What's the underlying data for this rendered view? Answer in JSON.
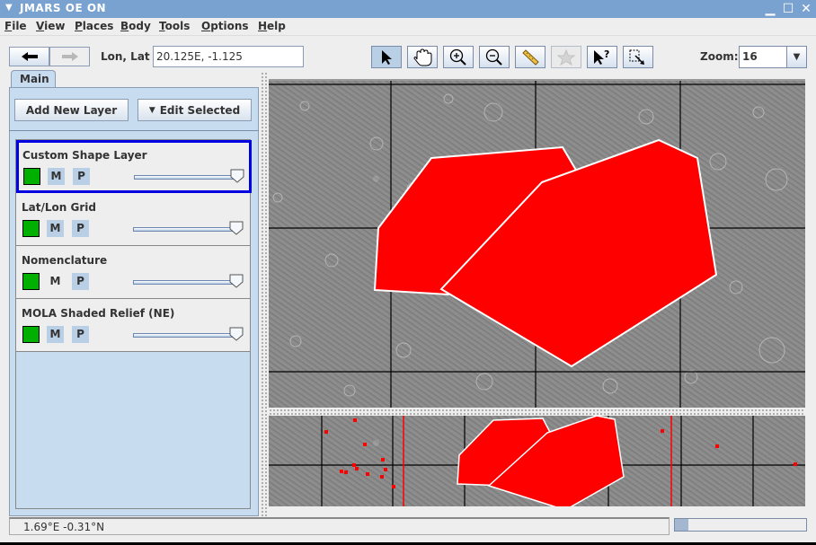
{
  "window": {
    "title": "JMARS OE ON",
    "menu_icon": "triangle-down-icon",
    "controls": [
      "minimize-icon",
      "maximize-icon",
      "close-icon"
    ]
  },
  "menubar": {
    "items": [
      {
        "label": "File",
        "mnemonic": "F",
        "rest": "ile"
      },
      {
        "label": "View",
        "mnemonic": "V",
        "rest": "iew"
      },
      {
        "label": "Places",
        "mnemonic": "P",
        "rest": "laces"
      },
      {
        "label": "Body",
        "mnemonic": "B",
        "rest": "ody"
      },
      {
        "label": "Tools",
        "mnemonic": "T",
        "rest": "ools"
      },
      {
        "label": "Options",
        "mnemonic": "O",
        "rest": "ptions"
      },
      {
        "label": "Help",
        "mnemonic": "H",
        "rest": "elp"
      }
    ]
  },
  "toolbar": {
    "back_icon": "arrow-left-icon",
    "forward_icon": "arrow-right-icon",
    "lonlat_label": "Lon, Lat",
    "lonlat_value": "20.125E, -1.125",
    "tools": [
      {
        "name": "select-tool",
        "icon": "arrow-pointer-icon",
        "active": true,
        "enabled": true
      },
      {
        "name": "pan-tool",
        "icon": "hand-icon",
        "active": false,
        "enabled": true
      },
      {
        "name": "zoom-in-tool",
        "icon": "zoom-in-icon",
        "active": false,
        "enabled": true
      },
      {
        "name": "zoom-out-tool",
        "icon": "zoom-out-icon",
        "active": false,
        "enabled": true
      },
      {
        "name": "measure-tool",
        "icon": "ruler-icon",
        "active": false,
        "enabled": true
      },
      {
        "name": "favorite-tool",
        "icon": "star-icon",
        "active": false,
        "enabled": false
      },
      {
        "name": "investigate-tool",
        "icon": "pointer-question-icon",
        "active": false,
        "enabled": true
      },
      {
        "name": "export-region-tool",
        "icon": "dashed-select-arrow-icon",
        "active": false,
        "enabled": true
      }
    ],
    "zoom_label": "Zoom:",
    "zoom_value": "16"
  },
  "panel": {
    "tab_label": "Main",
    "add_layer_label": "Add New Layer",
    "edit_selected_label": "Edit Selected",
    "layers": [
      {
        "name": "Custom Shape Layer",
        "color": "#00b000",
        "m_label": "M",
        "p_label": "P",
        "m_active": true,
        "opacity": 1.0,
        "selected": true
      },
      {
        "name": "Lat/Lon Grid",
        "color": "#00b000",
        "m_label": "M",
        "p_label": "P",
        "m_active": true,
        "opacity": 1.0,
        "selected": false
      },
      {
        "name": "Nomenclature",
        "color": "#00b000",
        "m_label": "M",
        "p_label": "P",
        "m_active": false,
        "opacity": 1.0,
        "selected": false
      },
      {
        "name": "MOLA Shaded Relief (NE)",
        "color": "#00b000",
        "m_label": "M",
        "p_label": "P",
        "m_active": true,
        "opacity": 1.0,
        "selected": false
      }
    ]
  },
  "map": {
    "shape_color": "#ff0000",
    "shape_outline": "#ffffff",
    "grid_color": "#000000",
    "overview_marker_color": "#ff0000"
  },
  "status": {
    "coords": "1.69°E  -0.31°N",
    "progress_fraction": 0.1
  }
}
